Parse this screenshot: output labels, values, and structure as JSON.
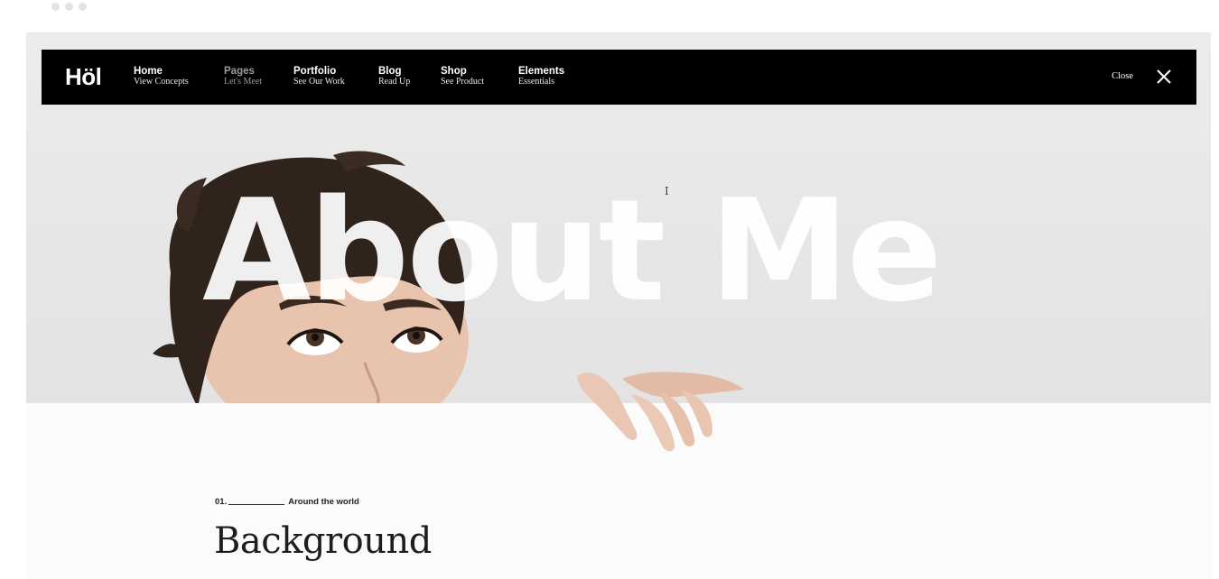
{
  "brand": {
    "logo": "Höl"
  },
  "nav": {
    "items": [
      {
        "title": "Home",
        "subtitle": "View Concepts"
      },
      {
        "title": "Pages",
        "subtitle": "Let's Meet"
      },
      {
        "title": "Portfolio",
        "subtitle": "See Our Work"
      },
      {
        "title": "Blog",
        "subtitle": "Read Up"
      },
      {
        "title": "Shop",
        "subtitle": "See Product"
      },
      {
        "title": "Elements",
        "subtitle": "Essentials"
      }
    ],
    "active_muted_index": 1,
    "close_label": "Close"
  },
  "hero": {
    "title": "About Me",
    "cursor_glyph": "I"
  },
  "section": {
    "number": "01.",
    "eyebrow": "Around the world",
    "title": "Background"
  },
  "icons": {
    "close": "close-icon",
    "window_dots": "window-dots"
  },
  "colors": {
    "navbar_bg": "#000000",
    "hero_bg": "#e8e8e8",
    "page_bg": "#fbfbfc"
  }
}
